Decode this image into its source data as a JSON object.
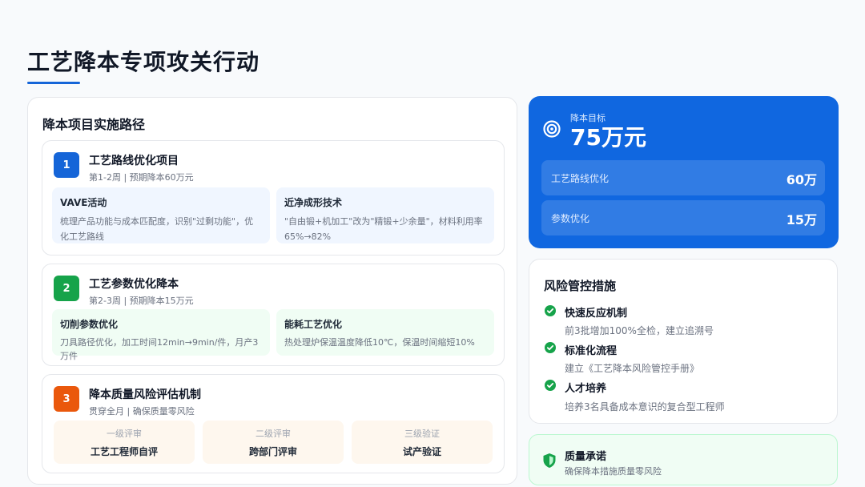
{
  "page": {
    "title": "工艺降本专项攻关行动"
  },
  "implementation": {
    "title": "降本项目实施路径",
    "projects": [
      {
        "number": "1",
        "title": "工艺路线优化项目",
        "subtitle": "第1-2周 | 预期降本60万元",
        "color": "#1565d8",
        "items": [
          {
            "title": "VAVE活动",
            "desc": "梳理产品功能与成本匹配度，识别\"过剩功能\"，优化工艺路线"
          },
          {
            "title": "近净成形技术",
            "desc": "\"自由锻+机加工\"改为\"精锻+少余量\"，材料利用率65%→82%"
          }
        ]
      },
      {
        "number": "2",
        "title": "工艺参数优化降本",
        "subtitle": "第2-3周 | 预期降本15万元",
        "color": "#16a34a",
        "items": [
          {
            "title": "切削参数优化",
            "desc": "刀具路径优化，加工时间12min→9min/件，月产3万件"
          },
          {
            "title": "能耗工艺优化",
            "desc": "热处理炉保温温度降低10℃，保温时间缩短10%"
          }
        ]
      },
      {
        "number": "3",
        "title": "降本质量风险评估机制",
        "subtitle": "贯穿全月 | 确保质量零风险",
        "color": "#ea580c",
        "levels": [
          {
            "label": "一级评审",
            "value": "工艺工程师自评"
          },
          {
            "label": "二级评审",
            "value": "跨部门评审"
          },
          {
            "label": "三级验证",
            "value": "试产验证"
          }
        ]
      }
    ]
  },
  "target": {
    "icon": "target-icon",
    "label": "降本目标",
    "value": "75万元",
    "breakdown": [
      {
        "label": "工艺路线优化",
        "value": "60万"
      },
      {
        "label": "参数优化",
        "value": "15万"
      }
    ]
  },
  "risk": {
    "title": "风险管控措施",
    "items": [
      {
        "title": "快速反应机制",
        "desc": "前3批增加100%全检，建立追溯号"
      },
      {
        "title": "标准化流程",
        "desc": "建立《工艺降本风险管控手册》"
      },
      {
        "title": "人才培养",
        "desc": "培养3名具备成本意识的复合型工程师"
      }
    ]
  },
  "quality": {
    "icon": "shield-icon",
    "title": "质量承诺",
    "desc": "确保降本措施质量零风险"
  }
}
